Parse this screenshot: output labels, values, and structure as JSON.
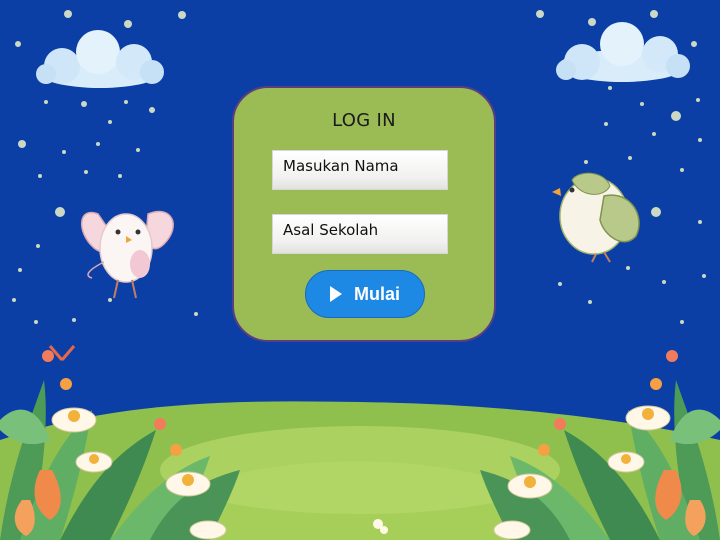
{
  "login": {
    "title": "LOG IN",
    "name_placeholder": "Masukan Nama",
    "school_placeholder": "Asal Sekolah",
    "start_label": "Mulai"
  },
  "colors": {
    "background": "#0B3FA6",
    "card": "#9BBB54",
    "card_border": "#5B3E82",
    "button": "#1E88E5"
  },
  "icons": [
    "play-icon",
    "cloud-icon",
    "bird-icon",
    "flower-icon"
  ]
}
